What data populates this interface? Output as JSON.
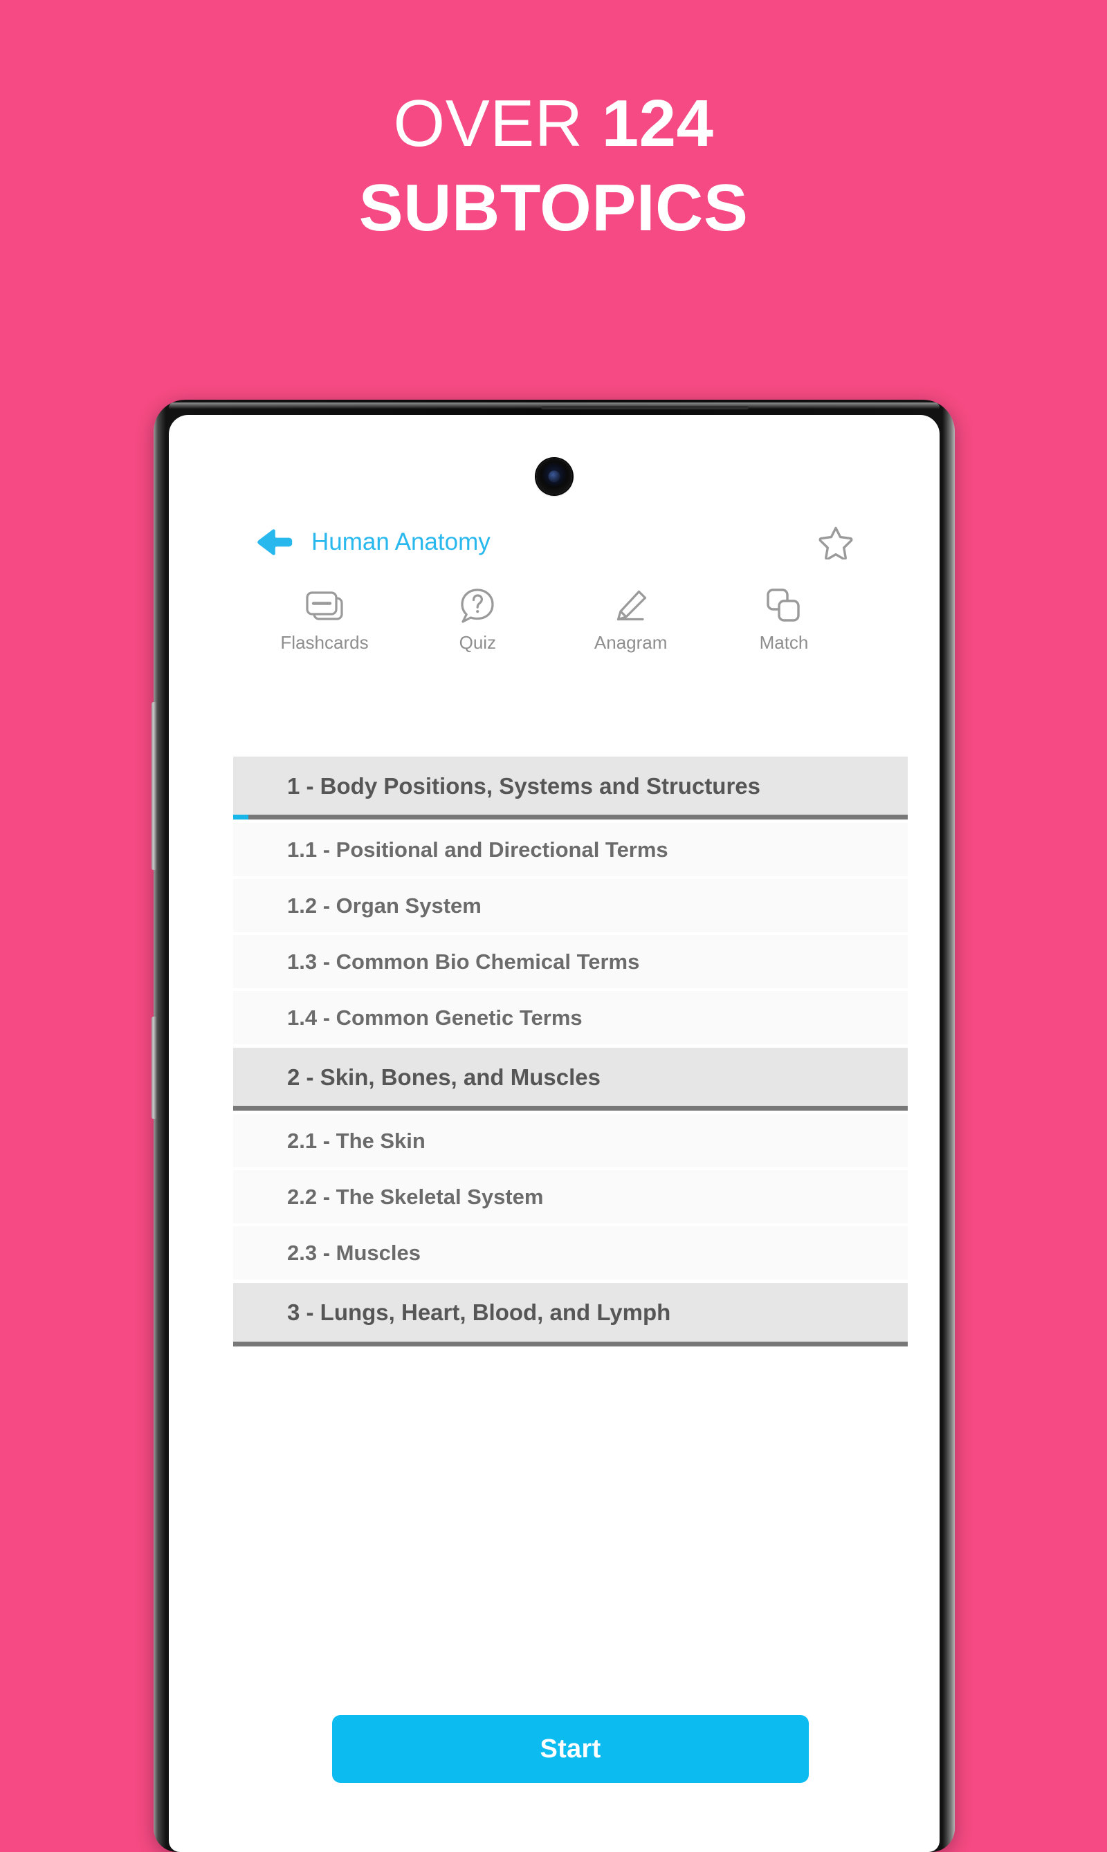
{
  "promo": {
    "headline_prefix": "OVER",
    "headline_number": "124",
    "headline_line2": "SUBTOPICS",
    "background_color": "#f54a83",
    "text_color": "#ffffff"
  },
  "app": {
    "header": {
      "back_icon": "back-arrow-icon",
      "title": "Human Anatomy",
      "title_color": "#29b8ee",
      "favorite_icon": "star-outline-icon"
    },
    "tabs": [
      {
        "label": "Flashcards",
        "icon": "flashcards-icon"
      },
      {
        "label": "Quiz",
        "icon": "question-bubble-icon"
      },
      {
        "label": "Anagram",
        "icon": "pencil-icon"
      },
      {
        "label": "Match",
        "icon": "overlapping-squares-icon"
      }
    ],
    "tab_color": "#8e8e8e",
    "accent_color": "#17b6e8",
    "list": [
      {
        "type": "section",
        "label": "1 - Body Positions, Systems and Structures",
        "accent": true
      },
      {
        "type": "item",
        "label": "1.1 - Positional and Directional Terms"
      },
      {
        "type": "item",
        "label": "1.2 - Organ System"
      },
      {
        "type": "item",
        "label": "1.3 - Common Bio Chemical Terms"
      },
      {
        "type": "item",
        "label": "1.4 - Common Genetic Terms"
      },
      {
        "type": "section",
        "label": "2 - Skin, Bones, and Muscles",
        "accent": false
      },
      {
        "type": "item",
        "label": "2.1 - The Skin"
      },
      {
        "type": "item",
        "label": "2.2 - The Skeletal System"
      },
      {
        "type": "item",
        "label": "2.3 - Muscles"
      },
      {
        "type": "section",
        "label": "3 - Lungs, Heart, Blood, and Lymph",
        "accent": false
      }
    ],
    "start_button": {
      "label": "Start",
      "color": "#0cbbf0"
    }
  }
}
